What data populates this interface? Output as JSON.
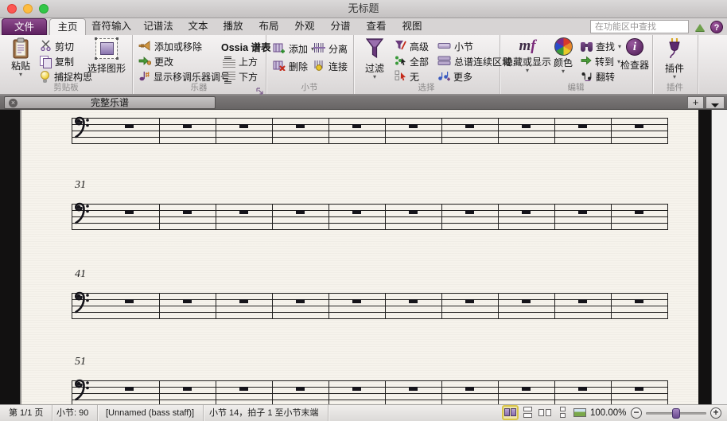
{
  "window": {
    "title": "无标题"
  },
  "tab_bar": {
    "file_tab": "文件",
    "tabs": [
      "主页",
      "音符输入",
      "记谱法",
      "文本",
      "播放",
      "布局",
      "外观",
      "分谱",
      "查看",
      "视图"
    ],
    "active_tab": "主页",
    "search_placeholder": "在功能区中查找"
  },
  "ribbon": {
    "clipboard": {
      "label": "剪贴板",
      "paste": "粘贴",
      "cut": "剪切",
      "copy": "复制",
      "capture_idea": "捕捉构思",
      "select_graphic": "选择图形"
    },
    "instruments": {
      "label": "乐器",
      "add_or_remove": "添加或移除",
      "change": "更改",
      "show_transposing": "显示移调乐器调号",
      "ossia_header": "Ossia 谱表",
      "above": "上方",
      "below": "下方"
    },
    "bars": {
      "label": "小节",
      "add": "添加",
      "delete": "删除",
      "split": "分离",
      "join": "连接"
    },
    "select": {
      "label": "选择",
      "filter": "过滤",
      "advanced": "高级",
      "all": "全部",
      "none": "无",
      "bars": "小节",
      "system_passage": "总谱连续区域",
      "more": "更多"
    },
    "edit": {
      "label": "编辑",
      "hide_show": "隐藏或显示",
      "color": "颜色",
      "find": "查找",
      "goto": "转到",
      "flip": "翻转",
      "inspector": "检查器"
    },
    "plugins": {
      "label": "插件",
      "plugins_button": "插件"
    }
  },
  "document_tabs": {
    "active": "完整乐谱",
    "add_button": "+"
  },
  "score": {
    "clef": "bass",
    "bars_per_system": 10,
    "systems": [
      {
        "bar_number": ""
      },
      {
        "bar_number": "31"
      },
      {
        "bar_number": "41"
      },
      {
        "bar_number": "51"
      }
    ]
  },
  "status_bar": {
    "page": "第 1/1 页",
    "bars_count": "小节: 90",
    "staff_name": "[Unnamed (bass staff)]",
    "selection": "小节 14，拍子 1 至小节末端",
    "zoom_level": "100.00%"
  },
  "icons": {
    "caret": "▾",
    "help": "?",
    "close": "×",
    "plus": "+",
    "minus": "−",
    "mf": "mf"
  },
  "colors": {
    "accent_purple": "#722d72",
    "paper": "#f6f3ec",
    "highlight_yellow": "#d8c44a"
  }
}
